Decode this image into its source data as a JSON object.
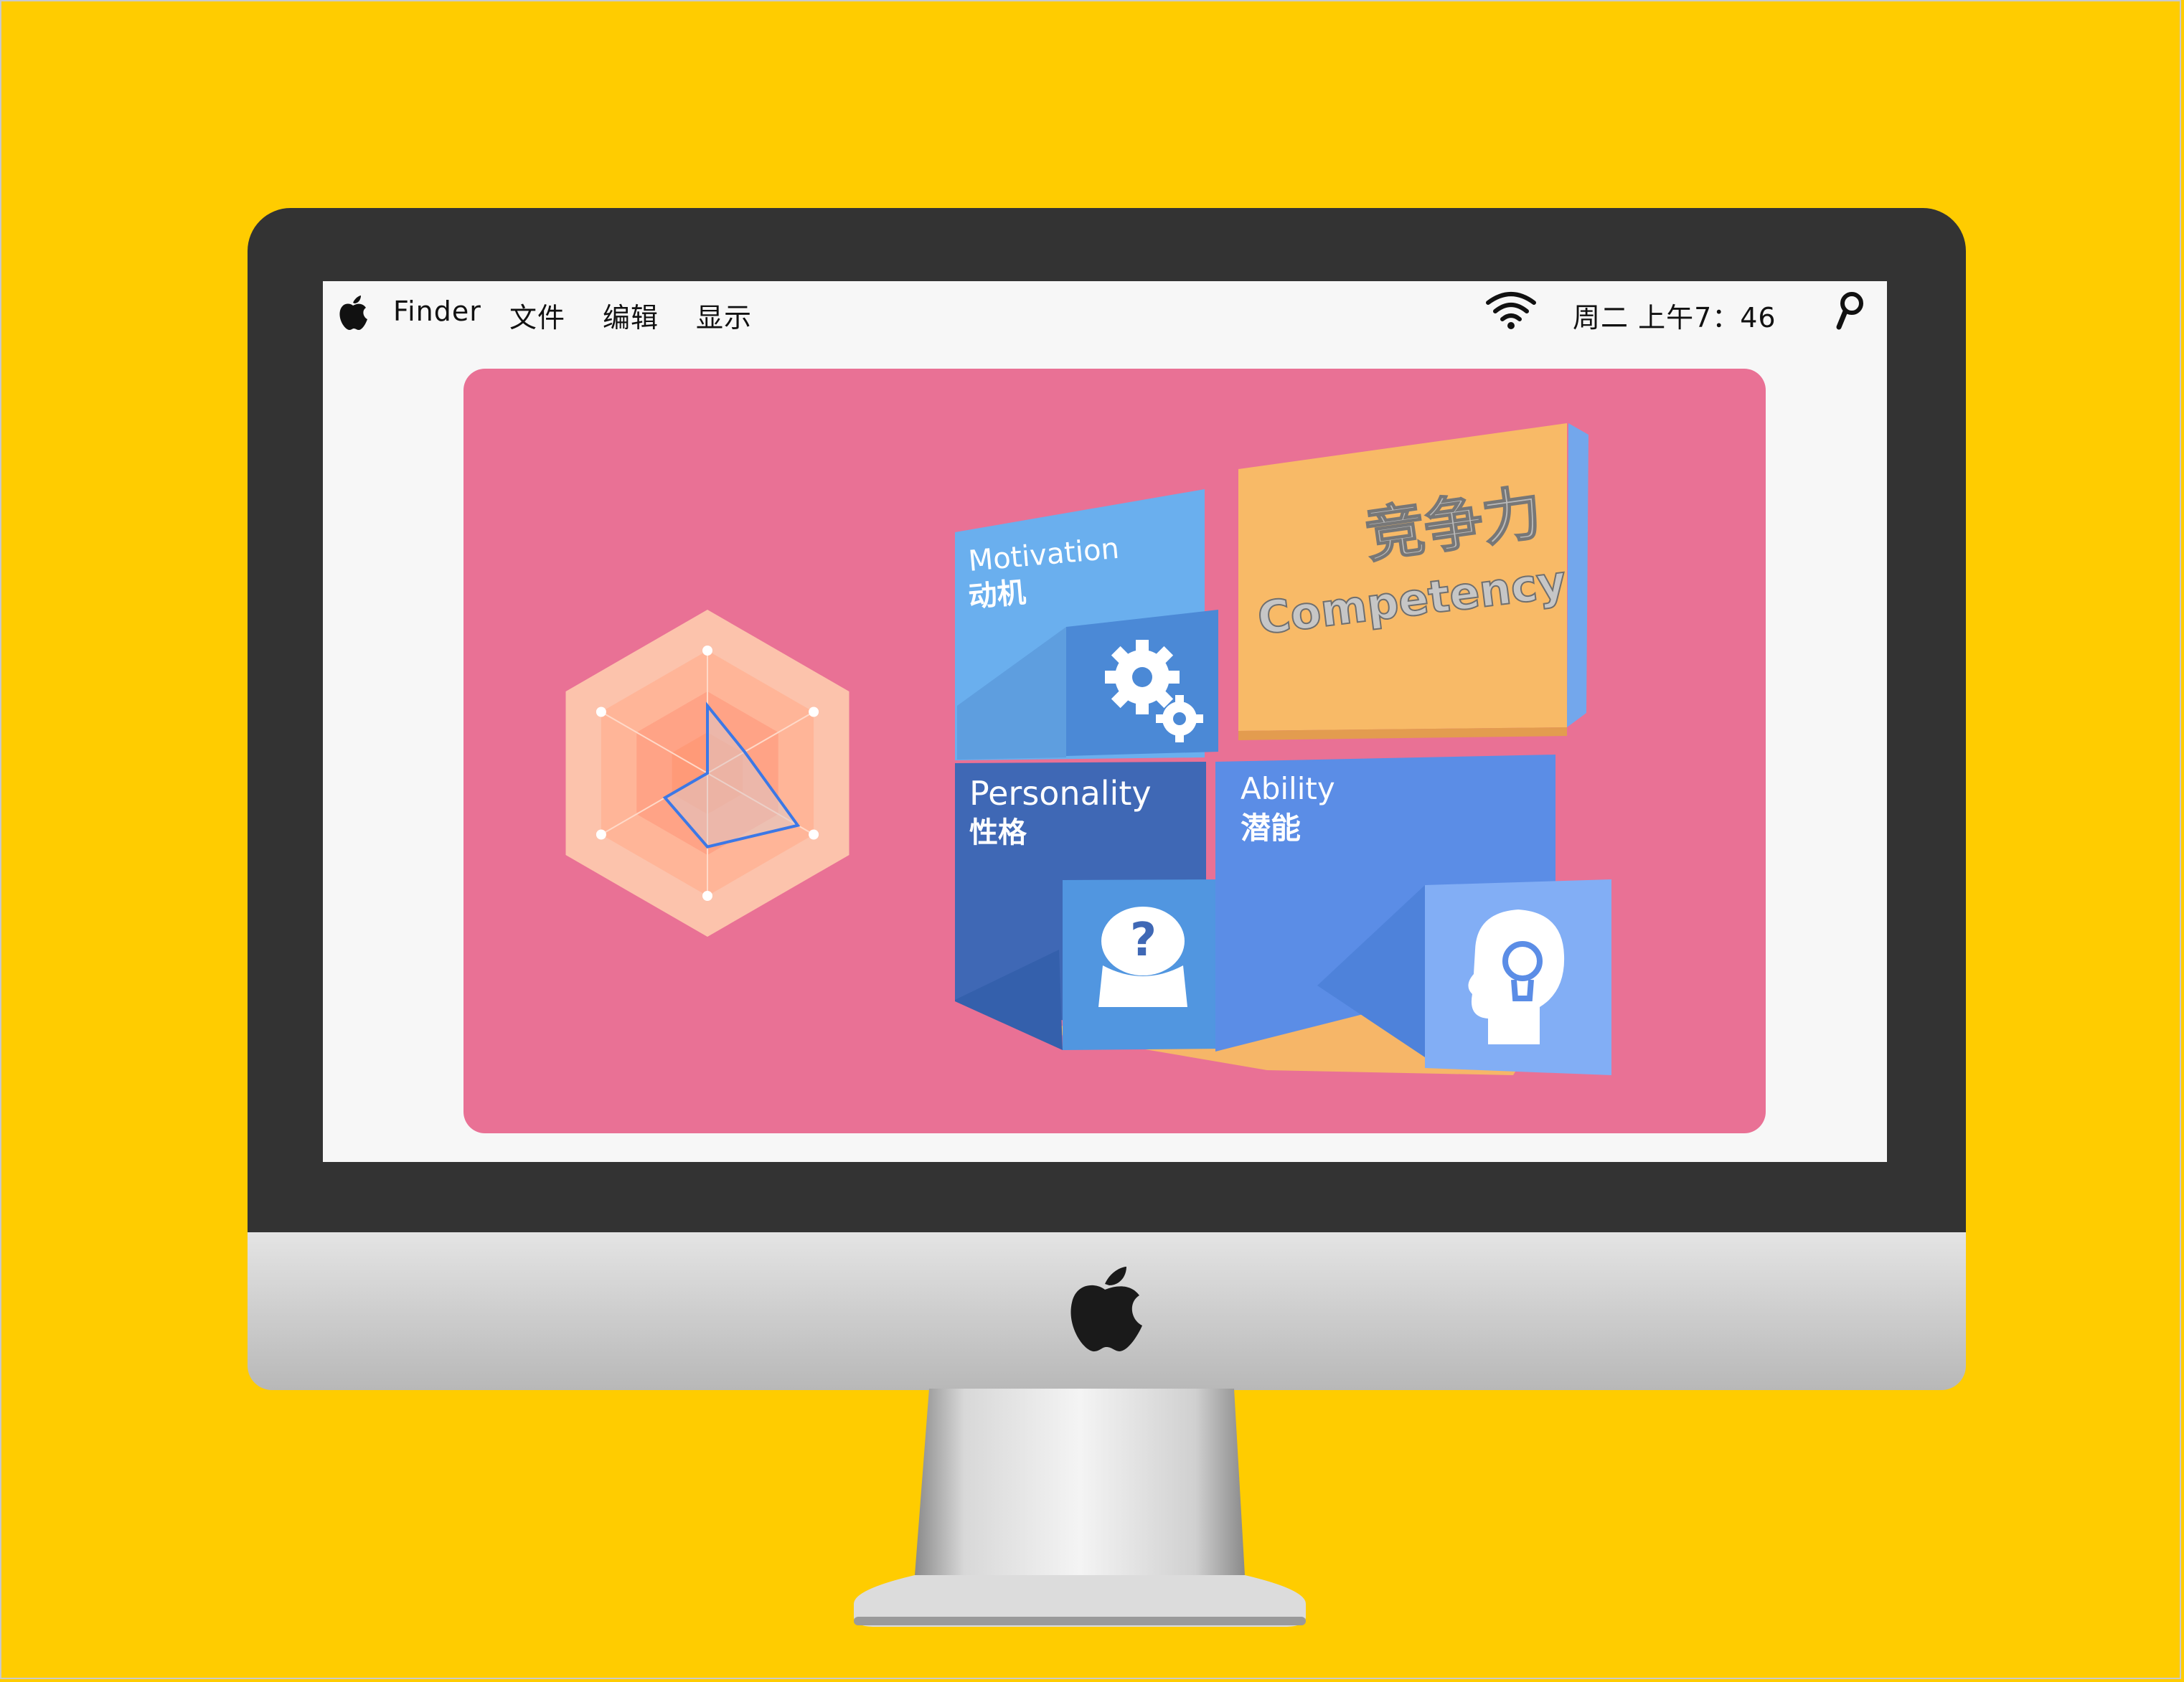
{
  "menubar": {
    "items": [
      "Finder",
      "文件",
      "编辑",
      "显示"
    ],
    "clock": "周二  上午7：46"
  },
  "radar": {
    "axis_labels": [
      "",
      "",
      "",
      "",
      "",
      ""
    ],
    "values": [
      0.55,
      0.35,
      0.85,
      0.6,
      0.4,
      0.0
    ]
  },
  "blocks": {
    "motivation": {
      "en": "Motivation",
      "zh": "动机",
      "icon": "gears-icon"
    },
    "competency": {
      "zh": "竞争力",
      "en": "Competency"
    },
    "personality": {
      "en": "Personality",
      "zh": "性格",
      "icon": "head-question-icon"
    },
    "ability": {
      "en": "Ability",
      "zh": "潜能",
      "icon": "head-lightbulb-icon"
    }
  },
  "colors": {
    "background": "#FFCC00",
    "slide": "#E97195",
    "motivation": "#6AB0EE",
    "competency": "#F9B96A",
    "personality": "#3F68B5",
    "ability": "#5B8DE6"
  }
}
